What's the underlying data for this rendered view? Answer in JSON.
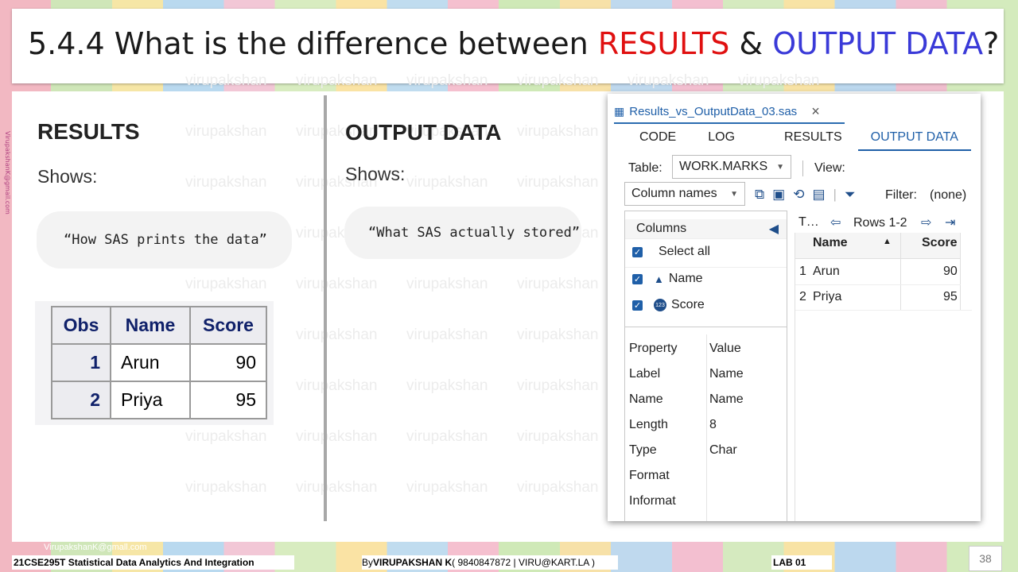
{
  "slide": {
    "title_prefix": "5.4.4 What is the difference between ",
    "title_results": "RESULTS",
    "title_amp": " & ",
    "title_output": "OUTPUT DATA",
    "title_suffix": "?",
    "watermark": "virupakshan",
    "side_watermark": "VirupakshanK@gmail.com",
    "colors": {
      "red": "#e01010",
      "blue": "#3a3ad8"
    }
  },
  "left": {
    "heading": "RESULTS",
    "shows": "Shows:",
    "quote": "“How SAS prints the data”",
    "table": {
      "headers": [
        "Obs",
        "Name",
        "Score"
      ],
      "rows": [
        [
          "1",
          "Arun",
          "90"
        ],
        [
          "2",
          "Priya",
          "95"
        ]
      ]
    }
  },
  "middle": {
    "heading": "OUTPUT DATA",
    "shows": "Shows:",
    "quote": "“What SAS actually stored”"
  },
  "sas_window": {
    "tab_title": "Results_vs_OutputData_03.sas",
    "close_glyph": "×",
    "tabs": [
      "CODE",
      "LOG",
      "RESULTS",
      "OUTPUT DATA"
    ],
    "table_label": "Table:",
    "table_value": "WORK.MARKS",
    "view_label": "View:",
    "column_names": "Column names",
    "filter_label": "Filter:",
    "filter_value": "(none)",
    "columns_title": "Columns",
    "select_all": "Select all",
    "columns": [
      "Name",
      "Score"
    ],
    "properties_header": [
      "Property",
      "Value"
    ],
    "properties": [
      [
        "Label",
        "Name"
      ],
      [
        "Name",
        "Name"
      ],
      [
        "Length",
        "8"
      ],
      [
        "Type",
        "Char"
      ],
      [
        "Format",
        ""
      ],
      [
        "Informat",
        ""
      ]
    ],
    "grid_nav": {
      "truncated": "T…",
      "rows_label": "Rows 1-2"
    },
    "grid_headers": [
      "Name",
      "Score"
    ],
    "grid_rows": [
      [
        "1",
        "Arun",
        "90"
      ],
      [
        "2",
        "Priya",
        "95"
      ]
    ]
  },
  "footer": {
    "email": "VirupakshanK@gmall.com",
    "course": "21CSE295T Statistical Data Analytics And Integration",
    "by_prefix": "By ",
    "author": "VIRUPAKSHAN K",
    "contact": " ( 9840847872 | VIRU@KART.LA )",
    "lab": "LAB  01",
    "page": "38"
  }
}
